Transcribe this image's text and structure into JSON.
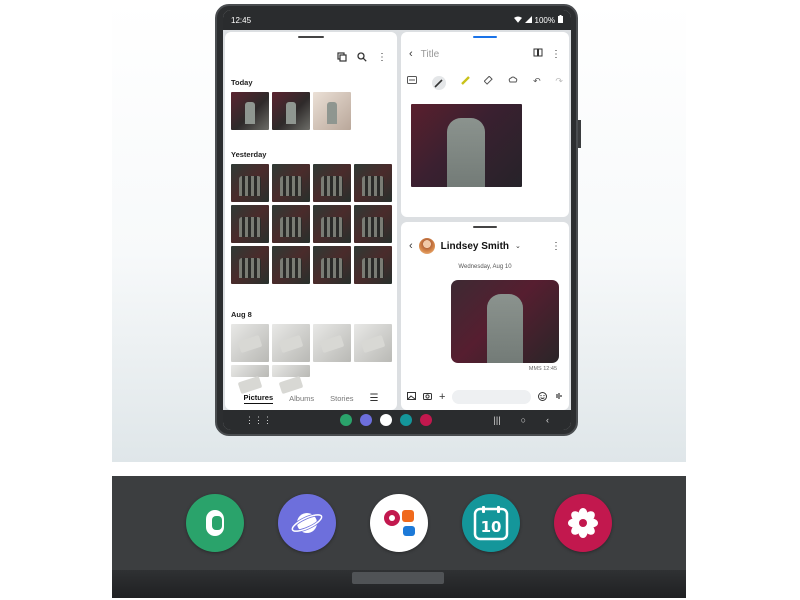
{
  "status_bar": {
    "time": "12:45",
    "battery": "100%"
  },
  "gallery": {
    "sections": [
      {
        "label": "Today",
        "count": 3
      },
      {
        "label": "Yesterday",
        "count": 12
      },
      {
        "label": "Aug 8",
        "count": 6
      }
    ],
    "tabs": [
      {
        "label": "Pictures",
        "active": true
      },
      {
        "label": "Albums",
        "active": false
      },
      {
        "label": "Stories",
        "active": false
      }
    ],
    "menu_icon": "hamburger-icon"
  },
  "notes": {
    "title_placeholder": "Title",
    "tools": [
      "text-box-icon",
      "pen-icon",
      "highlighter-icon",
      "eraser-icon",
      "lasso-icon",
      "undo-icon",
      "redo-icon"
    ]
  },
  "messages": {
    "contact_name": "Lindsey Smith",
    "date": "Wednesday, Aug 10",
    "timestamp": "MMS 12:45"
  },
  "dock_apps": [
    {
      "name": "phone-icon",
      "color": "#2aa36b"
    },
    {
      "name": "internet-icon",
      "color": "#6d6fdc"
    },
    {
      "name": "messages-icon",
      "color": "#ffffff"
    },
    {
      "name": "calendar-icon",
      "color": "#14969a",
      "text": "10"
    },
    {
      "name": "gallery-icon",
      "color": "#c2184e"
    }
  ]
}
